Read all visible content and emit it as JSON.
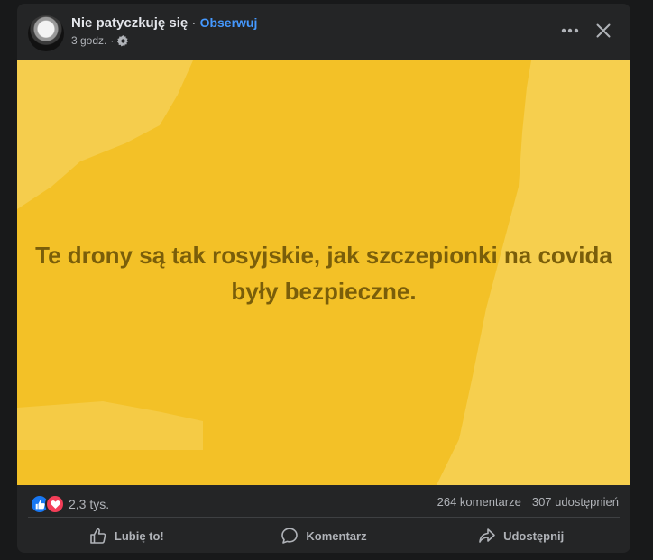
{
  "post": {
    "author": "Nie patyczkuję się",
    "separator": "·",
    "follow_label": "Obserwuj",
    "time": "3 godz.",
    "time_separator": "·",
    "privacy_icon": "gear-icon",
    "more_icon": "more-options-icon",
    "close_icon": "close-icon"
  },
  "image": {
    "text": "Te drony są tak rosyjskie, jak szczepionki na covida były bezpieczne.",
    "background_color": "#f3c127",
    "text_color": "#7a5e0a"
  },
  "stats": {
    "reaction_icons": [
      "like-reaction-icon",
      "love-reaction-icon"
    ],
    "reactions_count": "2,3 tys.",
    "comments": "264 komentarze",
    "shares": "307 udostępnień"
  },
  "actions": {
    "like_label": "Lubię to!",
    "comment_label": "Komentarz",
    "share_label": "Udostępnij"
  },
  "colors": {
    "page_background": "#18191a",
    "card_background": "#242526",
    "accent_link": "#4599ff",
    "text_primary": "#e4e6eb",
    "text_secondary": "#b0b3b8"
  }
}
